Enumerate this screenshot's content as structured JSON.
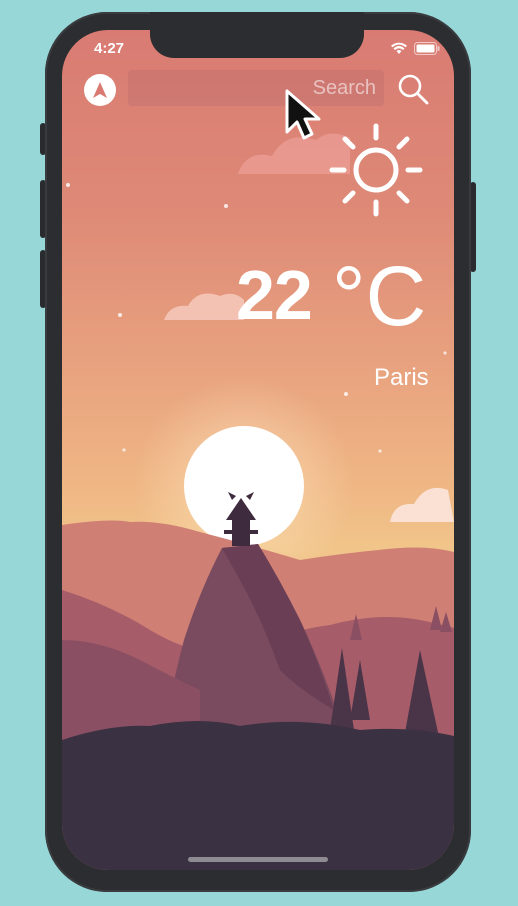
{
  "status_bar": {
    "time": "4:27"
  },
  "search": {
    "placeholder": "Search",
    "value": ""
  },
  "weather": {
    "temperature": "22",
    "unit": "°C",
    "city": "Paris",
    "condition_icon": "sun-icon"
  },
  "icons": {
    "locate": "location-arrow-icon",
    "search": "search-icon",
    "wifi": "wifi-icon",
    "battery": "battery-icon",
    "cursor": "mouse-cursor-icon"
  },
  "colors": {
    "background": "#97d7d8",
    "phone_frame": "#2c2d30",
    "sky_top": "#d97b73",
    "sky_horizon": "#f1c58a",
    "ground": "#3a3142",
    "text": "#ffffff"
  }
}
